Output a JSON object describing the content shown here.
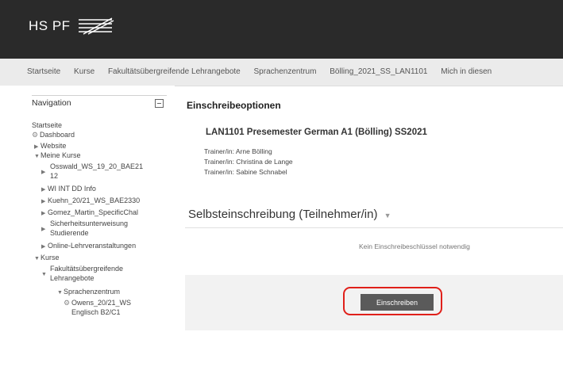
{
  "header": {
    "logo_text": "HS PF"
  },
  "navbar": {
    "items": [
      "Startseite",
      "Kurse",
      "Fakultätsübergreifende Lehrangebote",
      "Sprachenzentrum",
      "Bölling_2021_SS_LAN1101",
      "Mich in diesen"
    ]
  },
  "sidebar": {
    "title": "Navigation",
    "items": [
      "Startseite",
      "Dashboard",
      "Website",
      "Meine Kurse",
      "Osswald_WS_19_20_BAE21",
      "12",
      "WI INT DD Info",
      "Kuehn_20/21_WS_BAE2330",
      "Gomez_Martin_SpecificChal",
      "Sicherheitsunterweisung",
      "Studierende",
      "Online-Lehrveranstaltungen",
      "Kurse",
      "Fakultätsübergreifende",
      "Lehrangebote",
      "Sprachenzentrum",
      "Owens_20/21_WS",
      "Englisch B2/C1"
    ]
  },
  "main": {
    "title": "Einschreibeoptionen",
    "course_title": "LAN1101 Presemester German A1 (Bölling) SS2021",
    "trainers": [
      "Trainer/in: Arne Bölling",
      "Trainer/in: Christina de Lange",
      "Trainer/in: Sabine Schnabel"
    ],
    "section_title": "Selbsteinschreibung (Teilnehmer/in)",
    "no_key_text": "Kein Einschreibeschlüssel notwendig",
    "enrol_button": "Einschreiben"
  },
  "colors": {
    "header_bg": "#2a2a2a",
    "highlight": "#e0201a",
    "button_bg": "#5a5a5a"
  }
}
